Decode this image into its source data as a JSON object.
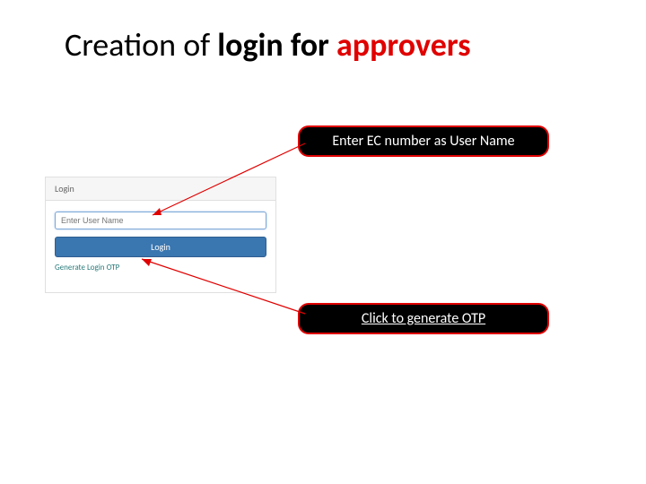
{
  "title": {
    "part1": "Creation of ",
    "part2": "login for ",
    "part3": "approvers"
  },
  "callouts": {
    "username": "Enter EC number as User Name",
    "otp": "Click to generate OTP"
  },
  "panel": {
    "header": "Login",
    "username_placeholder": "Enter User Name",
    "login_button": "Login",
    "generate_link": "Generate Login OTP"
  }
}
